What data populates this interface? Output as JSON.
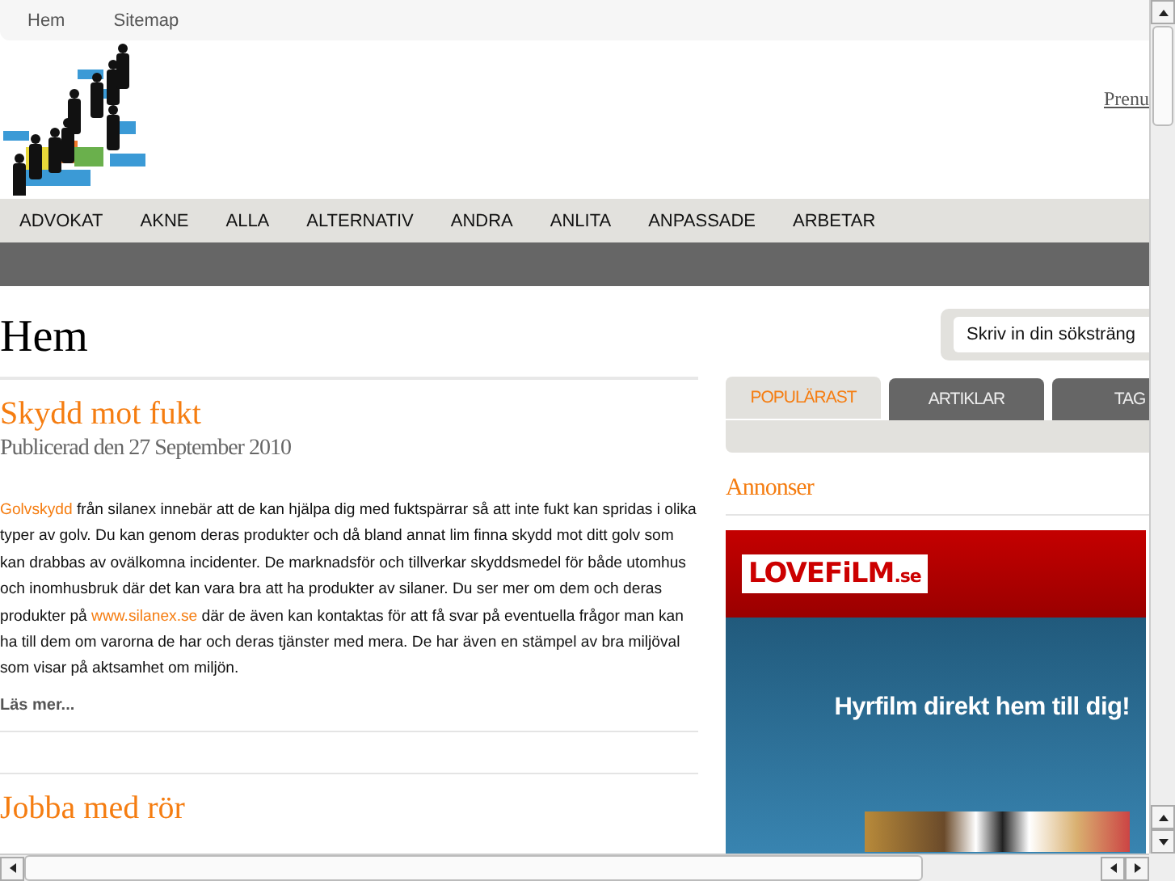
{
  "top_nav": [
    "Hem",
    "Sitemap"
  ],
  "header": {
    "link": "Prenu"
  },
  "menu": [
    "ADVOKAT",
    "AKNE",
    "ALLA",
    "ALTERNATIV",
    "ANDRA",
    "ANLITA",
    "ANPASSADE",
    "ARBETAR"
  ],
  "page_title": "Hem",
  "articles": [
    {
      "title": "Skydd mot fukt",
      "date": "Publicerad den 27 September 2010",
      "body": [
        {
          "kind": "link",
          "text": "Golvskydd"
        },
        {
          "kind": "text",
          "text": " från silanex innebär att de kan hjälpa dig med fuktspärrar så att inte fukt kan spridas i olika typer av golv. Du kan genom deras produkter och då bland annat lim finna skydd mot ditt golv som kan drabbas av ovälkomna incidenter. De marknadsför och tillverkar skyddsmedel för både utomhus och inomhusbruk där det kan vara bra att ha produkter av silaner. Du ser mer om dem och deras produkter på "
        },
        {
          "kind": "link",
          "text": "www.silanex.se"
        },
        {
          "kind": "text",
          "text": " där de även kan kontaktas för att få svar på eventuella frågor man kan ha till dem om varorna de har och deras tjänster med mera. De har även en stämpel av bra miljöval som visar på aktsamhet om miljön."
        }
      ],
      "more": "Läs mer..."
    },
    {
      "title": "Jobba med rör"
    }
  ],
  "search": {
    "placeholder": "Skriv in din söksträng"
  },
  "tabs": [
    {
      "label": "POPULÄRAST",
      "selected": true
    },
    {
      "label": "ARTIKLAR",
      "selected": false
    },
    {
      "label": "TAG",
      "selected": false
    }
  ],
  "ads": {
    "title": "Annonser",
    "banner": {
      "brand": "LOVEFiLM",
      "brand_suffix": ".se",
      "slogan": "Hyrfilm direkt hem till dig!"
    }
  }
}
